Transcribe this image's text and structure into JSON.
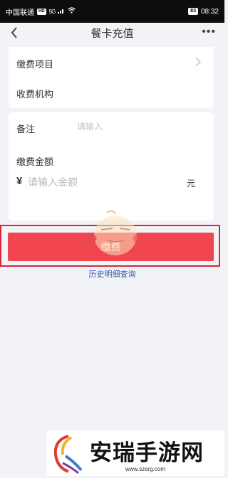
{
  "status_bar": {
    "carrier": "中国联通",
    "hd": "HD",
    "network": "5G",
    "battery": "83",
    "time": "08:32"
  },
  "nav": {
    "title": "餐卡充值",
    "back_icon": "chevron-left-icon",
    "more_icon": "more-dots-icon"
  },
  "form": {
    "payment_item_label": "缴费项目",
    "institution_label": "收费机构",
    "remark_label": "备注",
    "remark_placeholder": "请输入",
    "amount_label": "缴费金额",
    "currency_symbol": "¥",
    "amount_placeholder": "请输入金额",
    "unit": "元"
  },
  "pay_button_label": "缴费",
  "history_link": "历史明细查询",
  "watermark": {
    "text": "安瑞手游网",
    "url": "www.szerg.com"
  },
  "colors": {
    "accent": "#f14550",
    "highlight_border": "#d8253a",
    "link": "#2e57a8"
  }
}
